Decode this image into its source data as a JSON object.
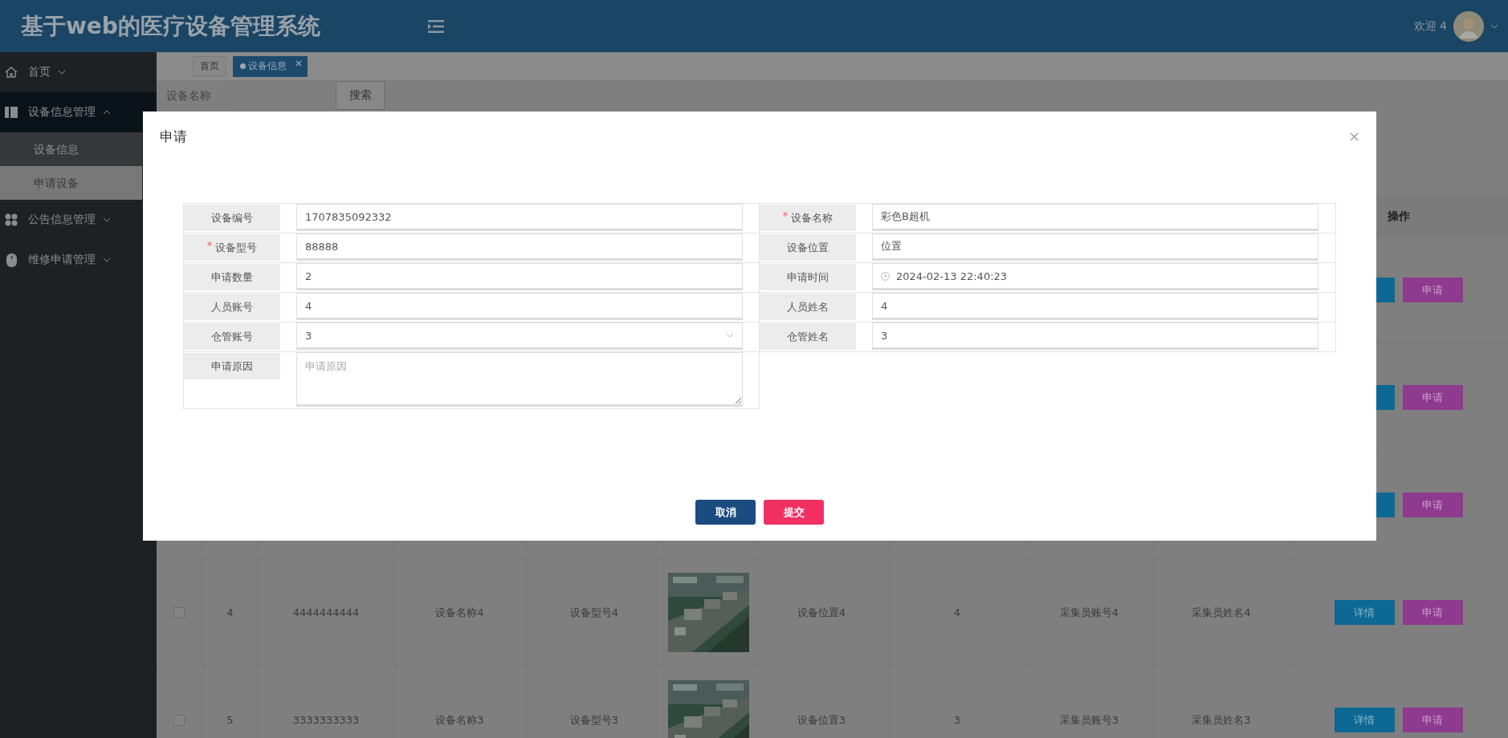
{
  "header": {
    "title": "基于web的医疗设备管理系统",
    "greeting": "欢迎 4"
  },
  "sidebar": {
    "items": [
      {
        "label": "首页",
        "expanded": false
      },
      {
        "label": "设备信息管理",
        "expanded": true,
        "children": [
          {
            "label": "设备信息",
            "selected": false
          },
          {
            "label": "申请设备",
            "selected": true
          }
        ]
      },
      {
        "label": "公告信息管理",
        "expanded": false
      },
      {
        "label": "维修申请管理",
        "expanded": false
      }
    ]
  },
  "tabs": [
    {
      "label": "首页",
      "selected": false
    },
    {
      "label": "设备信息",
      "selected": true
    }
  ],
  "search": {
    "placeholder": "设备名称",
    "button": "搜索"
  },
  "table": {
    "action_heading": "操作",
    "rows": [
      {
        "actions": [
          {
            "kind": "detail"
          },
          {
            "kind": "apply",
            "label": "申请"
          }
        ]
      },
      {
        "actions": [
          {
            "kind": "detail"
          },
          {
            "kind": "apply",
            "label": "申请"
          }
        ]
      },
      {
        "actions": [
          {
            "kind": "detail"
          },
          {
            "kind": "apply",
            "label": "申请"
          }
        ]
      },
      {
        "checked": false,
        "cells": [
          "4",
          "4444444444",
          "设备名称4",
          "设备型号4",
          {
            "kind": "picture"
          },
          "设备位置4",
          "4",
          "采集员账号4",
          "采集员姓名4"
        ],
        "actions": [
          {
            "kind": "detail",
            "label": "详情"
          },
          {
            "kind": "apply",
            "label": "申请"
          }
        ]
      },
      {
        "checked": false,
        "cells": [
          "5",
          "3333333333",
          "设备名称3",
          "设备型号3",
          {
            "kind": "picture"
          },
          "设备位置3",
          "3",
          "采集员账号3",
          "采集员姓名3"
        ],
        "actions": [
          {
            "kind": "detail",
            "label": "详情"
          },
          {
            "kind": "apply",
            "label": "申请"
          }
        ]
      }
    ]
  },
  "dialog": {
    "title": "申请",
    "fields": [
      {
        "label": "设备编号",
        "required": false,
        "kind": "text",
        "value": "1707835092332"
      },
      {
        "label": "设备名称",
        "required": true,
        "kind": "text",
        "value": "彩色B超机"
      },
      {
        "label": "设备型号",
        "required": true,
        "kind": "text",
        "value": "88888"
      },
      {
        "label": "设备位置",
        "required": false,
        "kind": "text",
        "value": "位置"
      },
      {
        "label": "申请数量",
        "required": false,
        "kind": "text",
        "value": "2"
      },
      {
        "label": "申请时间",
        "required": false,
        "kind": "datetime",
        "value": "2024-02-13 22:40:23"
      },
      {
        "label": "人员账号",
        "required": false,
        "kind": "text",
        "value": "4"
      },
      {
        "label": "人员姓名",
        "required": false,
        "kind": "text",
        "value": "4"
      },
      {
        "label": "仓管账号",
        "required": false,
        "kind": "select",
        "value": "3"
      },
      {
        "label": "仓管姓名",
        "required": false,
        "kind": "text",
        "value": "3"
      },
      {
        "label": "申请原因",
        "required": false,
        "kind": "textarea",
        "placeholder": "申请原因"
      }
    ],
    "buttons": [
      {
        "label": "取消",
        "kind": "cancel"
      },
      {
        "label": "提交",
        "kind": "submit"
      }
    ]
  }
}
